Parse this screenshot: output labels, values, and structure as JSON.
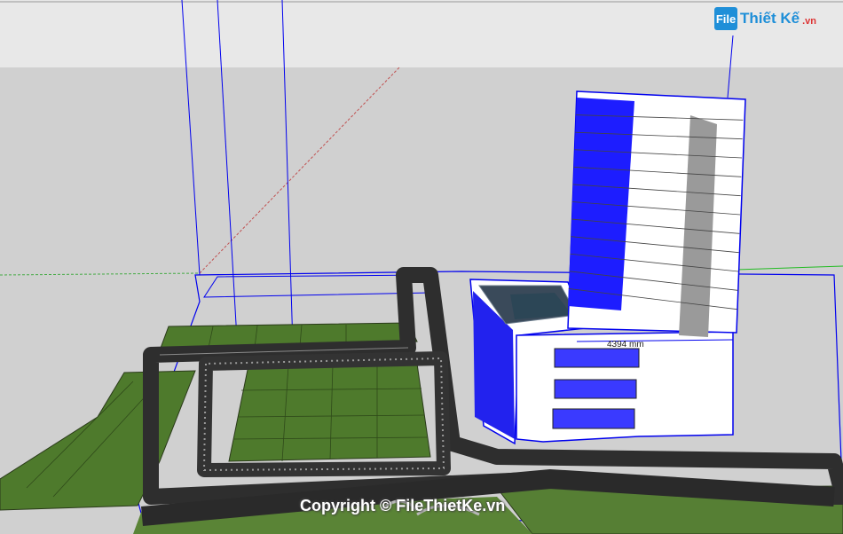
{
  "logo": {
    "icon_text": "File",
    "name": "Thiết Kế",
    "tld": ".vn"
  },
  "dimensions": {
    "building_width": "4394 mm",
    "left_marker": "",
    "right_marker": ""
  },
  "watermark": "Copyright © FileThietKe.vn",
  "colors": {
    "sky": "#e6e6e6",
    "ground": "#d2d2d2",
    "grass": "#4e7a2c",
    "road": "#3a3a3a",
    "selection": "#0000ff",
    "facade": "#ffffff",
    "glass": "#2a2aff"
  }
}
